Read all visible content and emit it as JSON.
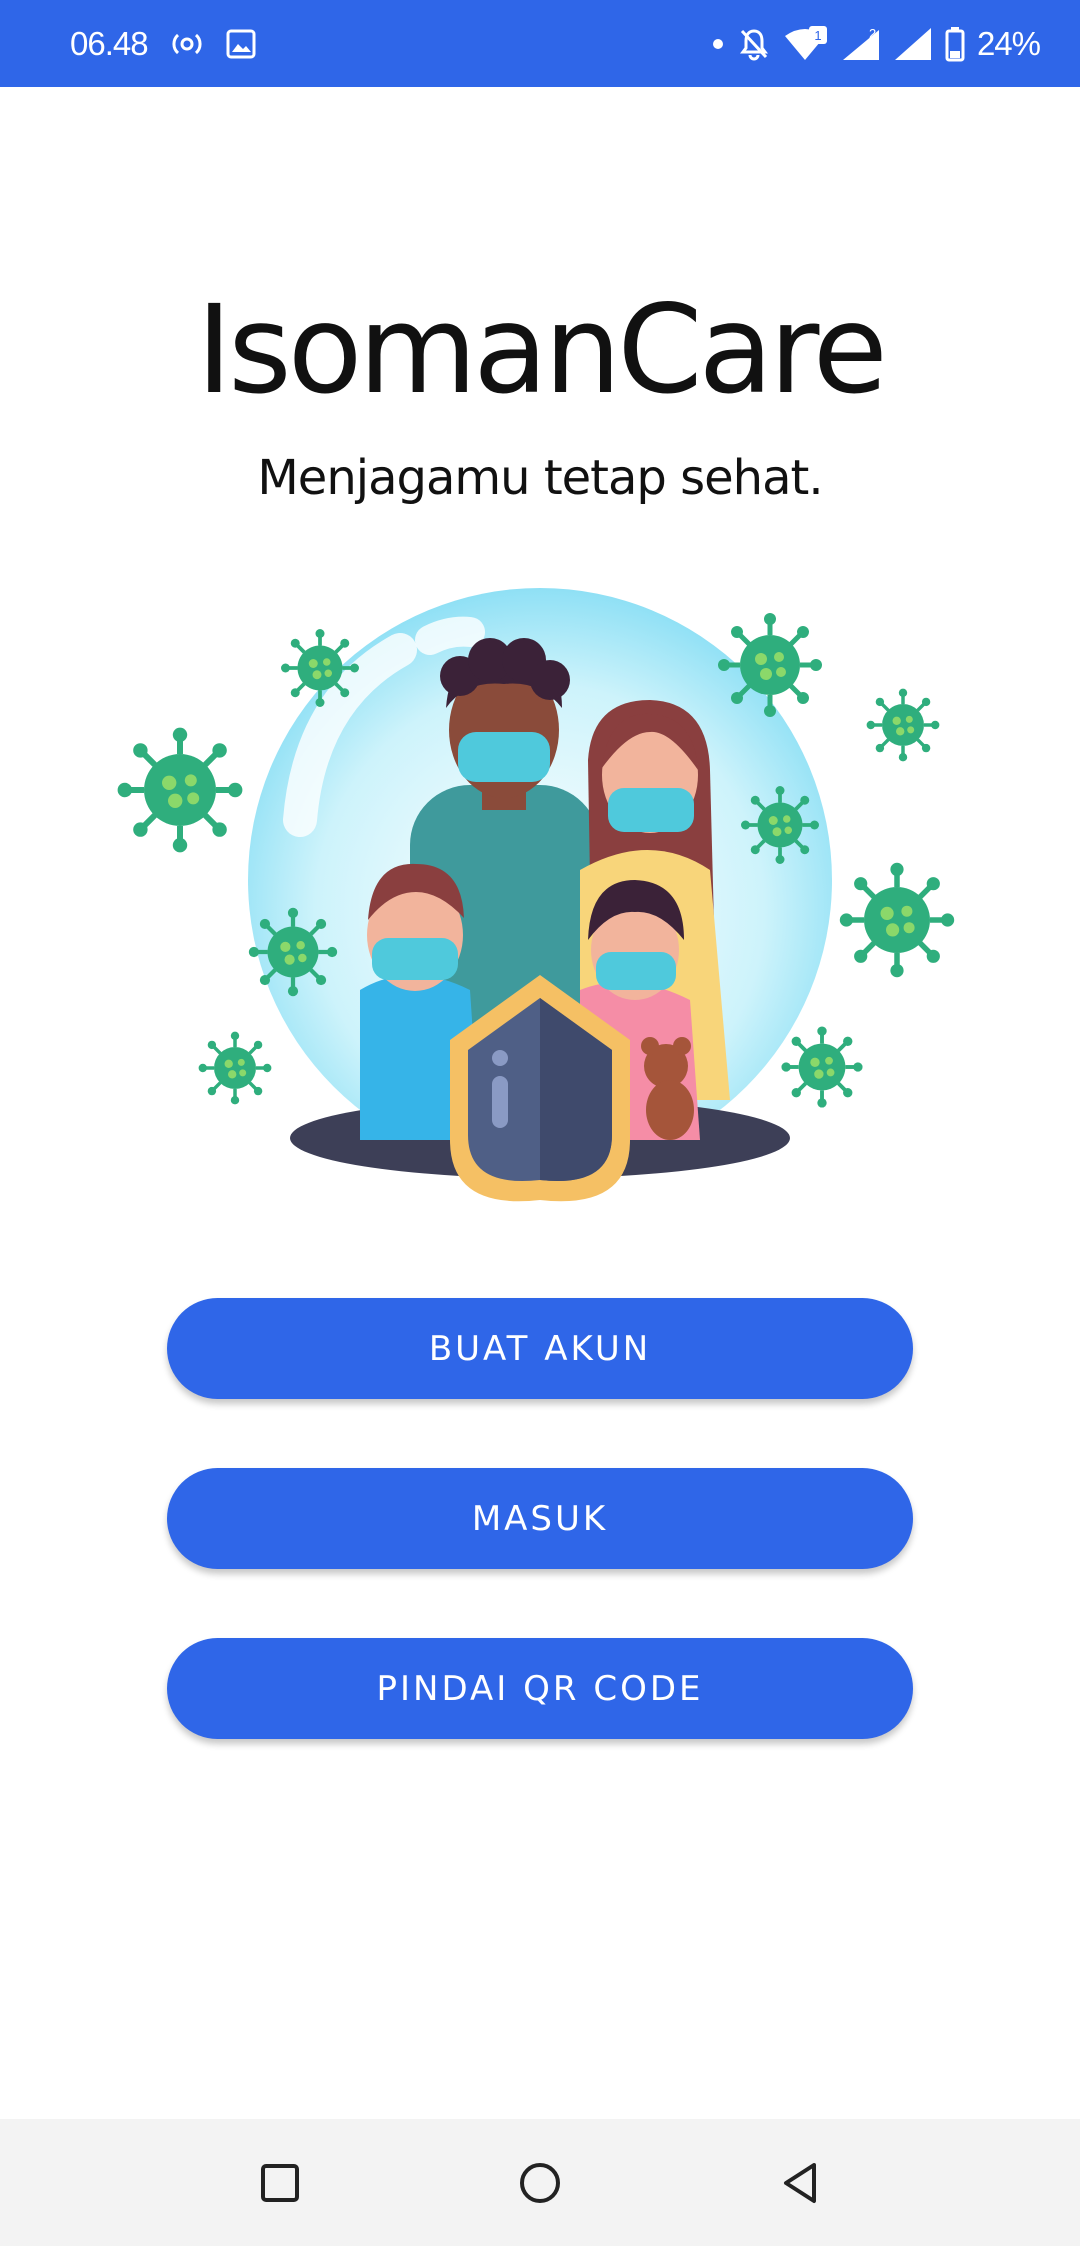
{
  "status_bar": {
    "time": "06.48",
    "battery": "24%",
    "sim1_badge": "1",
    "sim2_badge": "2"
  },
  "app": {
    "title": "IsomanCare",
    "tagline": "Menjagamu tetap sehat."
  },
  "buttons": {
    "create_account": "BUAT AKUN",
    "login": "MASUK",
    "scan_qr": "PINDAI QR CODE"
  },
  "colors": {
    "primary": "#2f66e8",
    "virus": "#2fae7d",
    "shield_gold": "#f5c064"
  },
  "icons": {
    "status_left": [
      "radio-icon",
      "image-icon"
    ],
    "status_right": [
      "dot-icon",
      "bell-off-icon",
      "wifi-icon",
      "signal-icon",
      "signal-icon",
      "battery-icon"
    ],
    "nav": [
      "recent-apps-icon",
      "home-icon",
      "back-icon"
    ]
  }
}
